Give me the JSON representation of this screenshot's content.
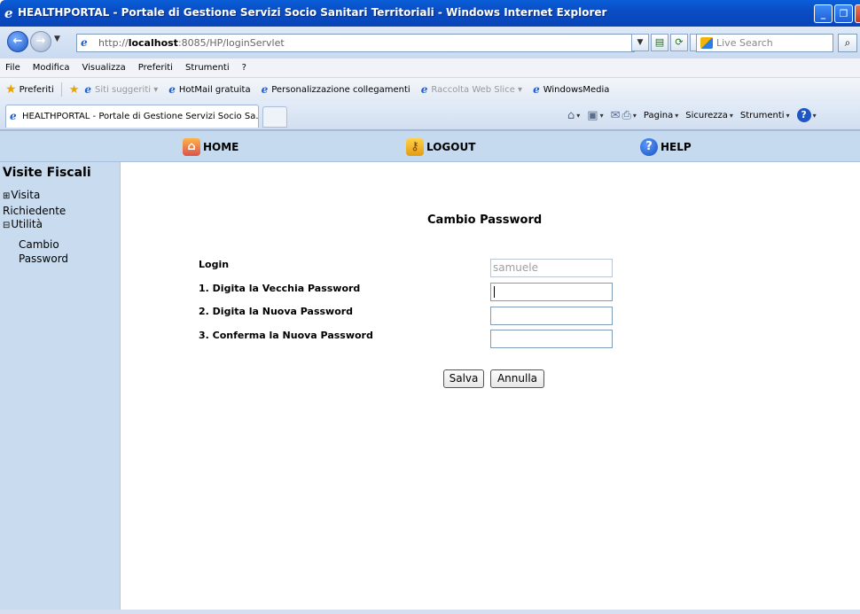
{
  "window": {
    "title": "HEALTHPORTAL - Portale di Gestione Servizi Socio Sanitari Territoriali - Windows Internet Explorer"
  },
  "address_bar": {
    "prefix": "http://",
    "host": "localhost",
    "rest": ":8085/HP/loginServlet",
    "search_placeholder": "Live Search"
  },
  "menu": [
    "File",
    "Modifica",
    "Visualizza",
    "Preferiti",
    "Strumenti",
    "?"
  ],
  "favorites": {
    "label": "Preferiti",
    "items": [
      {
        "label": "Siti suggeriti ▾"
      },
      {
        "label": "HotMail gratuita"
      },
      {
        "label": "Personalizzazione collegamenti"
      },
      {
        "label": "Raccolta Web Slice ▾"
      },
      {
        "label": "WindowsMedia"
      }
    ]
  },
  "tab": {
    "label": "HEALTHPORTAL - Portale di Gestione Servizi Socio Sa..."
  },
  "command_bar": {
    "page": "Pagina",
    "security": "Sicurezza",
    "tools": "Strumenti"
  },
  "topnav": {
    "home": "HOME",
    "logout": "LOGOUT",
    "help": "HELP"
  },
  "sidebar": {
    "title": "Visite Fiscali",
    "items": [
      {
        "toggle": "⊞",
        "label_line1": "Visita",
        "label_line2": "Richiedente"
      },
      {
        "toggle": "⊟",
        "label_line1": "Utilità"
      }
    ],
    "sub": {
      "line1": "Cambio",
      "line2": "Password"
    }
  },
  "form": {
    "title": "Cambio Password",
    "login_label": "Login",
    "login_value": "samuele",
    "old_label": "1. Digita la Vecchia Password",
    "new_label": "2. Digita la Nuova Password",
    "confirm_label": "3. Conferma la Nuova Password",
    "save": "Salva",
    "cancel": "Annulla"
  }
}
